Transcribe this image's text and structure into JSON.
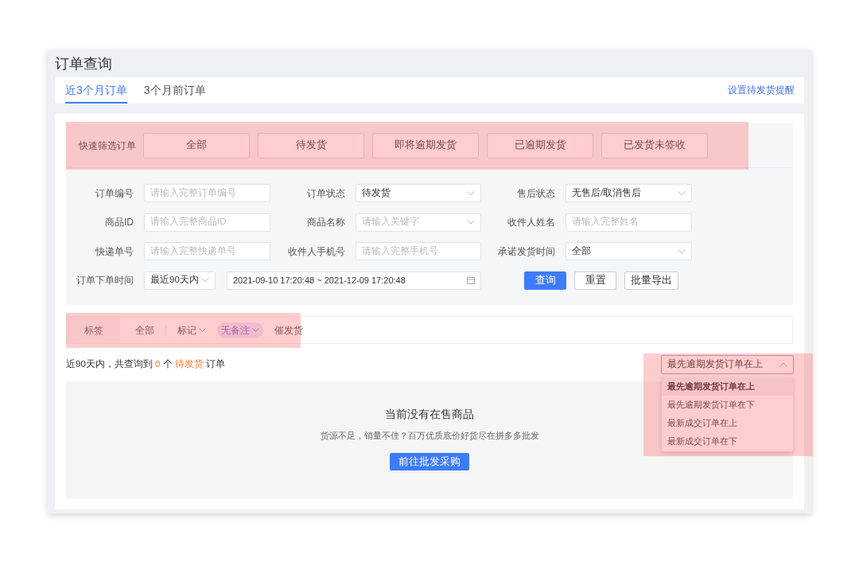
{
  "page": {
    "title": "订单查询"
  },
  "tabs": [
    {
      "label": "近3个月订单",
      "selected": true
    },
    {
      "label": "3个月前订单",
      "selected": false
    }
  ],
  "reminder_link": "设置待发货提醒",
  "quick_filter": {
    "label": "快速筛选订单",
    "highlighted": true,
    "buttons": [
      "全部",
      "待发货",
      "即将逾期发货",
      "已逾期发货",
      "已发货未签收"
    ]
  },
  "search_form": {
    "fields": [
      {
        "kind": "input",
        "label": "订单编号",
        "placeholder": "请输入完整订单编号"
      },
      {
        "kind": "select",
        "label": "订单状态",
        "value": "待发货"
      },
      {
        "kind": "select",
        "label": "售后状态",
        "value": "无售后/取消售后"
      },
      {
        "kind": "input",
        "label": "商品ID",
        "placeholder": "请输入完整商品ID"
      },
      {
        "kind": "select",
        "label": "商品名称",
        "placeholder": "请输入关键字"
      },
      {
        "kind": "input",
        "label": "收件人姓名",
        "placeholder": "请输入完整姓名"
      },
      {
        "kind": "input",
        "label": "快递单号",
        "placeholder": "请输入完整快递单号"
      },
      {
        "kind": "input",
        "label": "收件人手机号",
        "placeholder": "请输入完整手机号"
      },
      {
        "kind": "select",
        "label": "承诺发货时间",
        "value": "全部"
      }
    ],
    "order_time": {
      "label": "订单下单时间",
      "range_select": "最近90天内",
      "date_range": "2021-09-10 17:20:48 ~ 2021-12-09 17:20:48"
    },
    "buttons": [
      {
        "label": "查询",
        "primary": true
      },
      {
        "label": "重置",
        "primary": false
      },
      {
        "label": "批量导出",
        "primary": false
      }
    ]
  },
  "tag_bar": {
    "label": "标签",
    "highlighted": true,
    "items": [
      {
        "label": "全部",
        "dropdown": false,
        "selected": false
      },
      {
        "label": "标记",
        "dropdown": true,
        "selected": false
      },
      {
        "label": "无备注",
        "dropdown": true,
        "selected": true
      },
      {
        "label": "催发货",
        "dropdown": false,
        "selected": false
      }
    ]
  },
  "result_summary": [
    {
      "text": "近90天内，共查询到",
      "accent": false
    },
    {
      "text": "0",
      "accent": true
    },
    {
      "text": "个",
      "accent": false
    },
    {
      "text": "待发货",
      "accent": true
    },
    {
      "text": "订单",
      "accent": false
    }
  ],
  "sort": {
    "value": "最先逾期发货订单在上",
    "expanded": true,
    "highlighted": true,
    "options": [
      {
        "label": "最先逾期发货订单在上",
        "selected": true
      },
      {
        "label": "最先逾期发货订单在下",
        "selected": false
      },
      {
        "label": "最新成交订单在上",
        "selected": false
      },
      {
        "label": "最新成交订单在下",
        "selected": false
      }
    ]
  },
  "empty_state": {
    "title": "当前没有在售商品",
    "message": "货源不足，销量不佳？百万优质底价好货尽在拼多多批发",
    "button": "前往批发采购"
  }
}
